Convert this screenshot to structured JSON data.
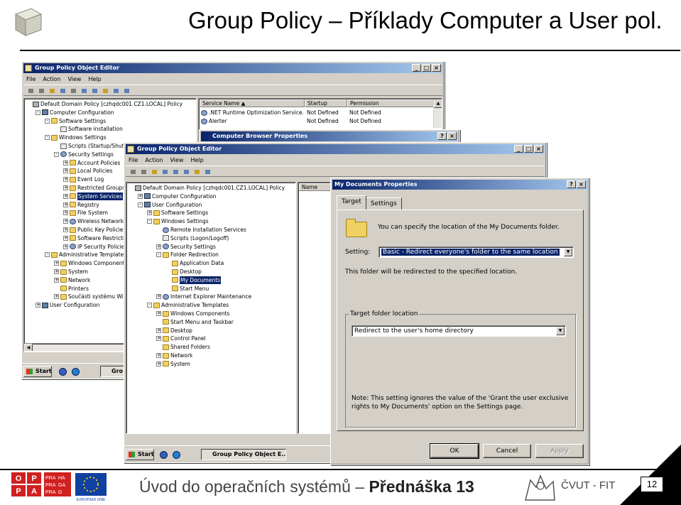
{
  "slide": {
    "title": "Group Policy – Příklady Computer a User pol.",
    "footer": "Úvod do operačních systémů – ",
    "footer_bold": "Přednáška 13",
    "institution": "ČVUT - FIT",
    "page_number": "12",
    "oppa": {
      "letters": [
        "O",
        "P",
        "P",
        "A"
      ],
      "praha": [
        "PRA",
        "HA",
        "PRA",
        "GA",
        "PRA",
        "G"
      ]
    },
    "eu_label": "EVROPSKÁ UNIE"
  },
  "back_window": {
    "title": "Group Policy Object Editor",
    "menu": [
      "File",
      "Action",
      "View",
      "Help"
    ],
    "tree": [
      {
        "label": "Default Domain Policy [czhqdc001.CZ1.LOCAL] Policy",
        "indent": 0,
        "exp": "",
        "icon": "policy"
      },
      {
        "label": "Computer Configuration",
        "indent": 1,
        "exp": "-",
        "icon": "computer"
      },
      {
        "label": "Software Settings",
        "indent": 2,
        "exp": "-",
        "icon": "folder"
      },
      {
        "label": "Software installation",
        "indent": 3,
        "exp": "",
        "icon": "doc"
      },
      {
        "label": "Windows Settings",
        "indent": 2,
        "exp": "-",
        "icon": "folder"
      },
      {
        "label": "Scripts (Startup/Shutdo",
        "indent": 3,
        "exp": "",
        "icon": "doc"
      },
      {
        "label": "Security Settings",
        "indent": 3,
        "exp": "-",
        "icon": "gear"
      },
      {
        "label": "Account Policies",
        "indent": 4,
        "exp": "+",
        "icon": "folder"
      },
      {
        "label": "Local Policies",
        "indent": 4,
        "exp": "+",
        "icon": "folder"
      },
      {
        "label": "Event Log",
        "indent": 4,
        "exp": "+",
        "icon": "folder"
      },
      {
        "label": "Restricted Groups",
        "indent": 4,
        "exp": "+",
        "icon": "folder"
      },
      {
        "label": "System Services",
        "indent": 4,
        "exp": "+",
        "icon": "folder",
        "selected": true
      },
      {
        "label": "Registry",
        "indent": 4,
        "exp": "+",
        "icon": "folder"
      },
      {
        "label": "File System",
        "indent": 4,
        "exp": "+",
        "icon": "folder"
      },
      {
        "label": "Wireless Network (I",
        "indent": 4,
        "exp": "+",
        "icon": "gear"
      },
      {
        "label": "Public Key Policies",
        "indent": 4,
        "exp": "+",
        "icon": "folder"
      },
      {
        "label": "Software Restrictio",
        "indent": 4,
        "exp": "+",
        "icon": "folder"
      },
      {
        "label": "IP Security Policies c",
        "indent": 4,
        "exp": "+",
        "icon": "gear"
      },
      {
        "label": "Administrative Templates",
        "indent": 2,
        "exp": "-",
        "icon": "folder"
      },
      {
        "label": "Windows Components",
        "indent": 3,
        "exp": "+",
        "icon": "folder"
      },
      {
        "label": "System",
        "indent": 3,
        "exp": "+",
        "icon": "folder"
      },
      {
        "label": "Network",
        "indent": 3,
        "exp": "+",
        "icon": "folder"
      },
      {
        "label": "Printers",
        "indent": 3,
        "exp": "",
        "icon": "folder"
      },
      {
        "label": "Součásti systému Wind",
        "indent": 3,
        "exp": "+",
        "icon": "folder"
      },
      {
        "label": "User Configuration",
        "indent": 1,
        "exp": "+",
        "icon": "computer"
      }
    ],
    "columns": [
      "Service Name",
      "Startup",
      "Permission"
    ],
    "rows": [
      [
        ".NET Runtime Optimization Service...",
        "Not Defined",
        "Not Defined"
      ],
      [
        "Alerter",
        "Not Defined",
        "Not Defined"
      ]
    ],
    "taskbar_start": "Start",
    "taskbar_item": "Gro"
  },
  "browser_props_title": "Computer Browser Properties",
  "mid_window": {
    "title": "Group Policy Object Editor",
    "menu": [
      "File",
      "Action",
      "View",
      "Help"
    ],
    "tree": [
      {
        "label": "Default Domain Policy [czhqdc001.CZ1.LOCAL] Policy",
        "indent": 0,
        "exp": "",
        "icon": "policy"
      },
      {
        "label": "Computer Configuration",
        "indent": 1,
        "exp": "+",
        "icon": "computer"
      },
      {
        "label": "User Configuration",
        "indent": 1,
        "exp": "-",
        "icon": "computer"
      },
      {
        "label": "Software Settings",
        "indent": 2,
        "exp": "+",
        "icon": "folder"
      },
      {
        "label": "Windows Settings",
        "indent": 2,
        "exp": "-",
        "icon": "folder"
      },
      {
        "label": "Remote Installation Services",
        "indent": 3,
        "exp": "",
        "icon": "gear"
      },
      {
        "label": "Scripts (Logon/Logoff)",
        "indent": 3,
        "exp": "",
        "icon": "doc"
      },
      {
        "label": "Security Settings",
        "indent": 3,
        "exp": "+",
        "icon": "gear"
      },
      {
        "label": "Folder Redirection",
        "indent": 3,
        "exp": "-",
        "icon": "folder"
      },
      {
        "label": "Application Data",
        "indent": 4,
        "exp": "",
        "icon": "folder"
      },
      {
        "label": "Desktop",
        "indent": 4,
        "exp": "",
        "icon": "folder"
      },
      {
        "label": "My Documents",
        "indent": 4,
        "exp": "",
        "icon": "folder",
        "selected": true
      },
      {
        "label": "Start Menu",
        "indent": 4,
        "exp": "",
        "icon": "folder"
      },
      {
        "label": "Internet Explorer Maintenance",
        "indent": 3,
        "exp": "+",
        "icon": "gear"
      },
      {
        "label": "Administrative Templates",
        "indent": 2,
        "exp": "-",
        "icon": "folder"
      },
      {
        "label": "Windows Components",
        "indent": 3,
        "exp": "+",
        "icon": "folder"
      },
      {
        "label": "Start Menu and Taskbar",
        "indent": 3,
        "exp": "",
        "icon": "folder"
      },
      {
        "label": "Desktop",
        "indent": 3,
        "exp": "+",
        "icon": "folder"
      },
      {
        "label": "Control Panel",
        "indent": 3,
        "exp": "+",
        "icon": "folder"
      },
      {
        "label": "Shared Folders",
        "indent": 3,
        "exp": "",
        "icon": "folder"
      },
      {
        "label": "Network",
        "indent": 3,
        "exp": "+",
        "icon": "folder"
      },
      {
        "label": "System",
        "indent": 3,
        "exp": "+",
        "icon": "folder"
      }
    ],
    "columns": [
      "Name"
    ],
    "taskbar_start": "Start",
    "taskbar_item": "Group Policy Object E..."
  },
  "dialog": {
    "title": "My Documents Properties",
    "tabs": [
      "Target",
      "Settings"
    ],
    "intro": "You can specify the location of the My Documents folder.",
    "setting_label": "Setting:",
    "setting_value": "Basic - Redirect everyone's folder to the same location",
    "redirect_note": "This folder will be redirected to the specified location.",
    "target_group": "Target folder location",
    "target_value": "Redirect to the user's home directory",
    "note_line1": "Note: This setting ignores the value of the 'Grant the user exclusive",
    "note_line2": "rights to My Documents' option on the Settings page.",
    "ok": "OK",
    "cancel": "Cancel",
    "apply": "Apply"
  }
}
